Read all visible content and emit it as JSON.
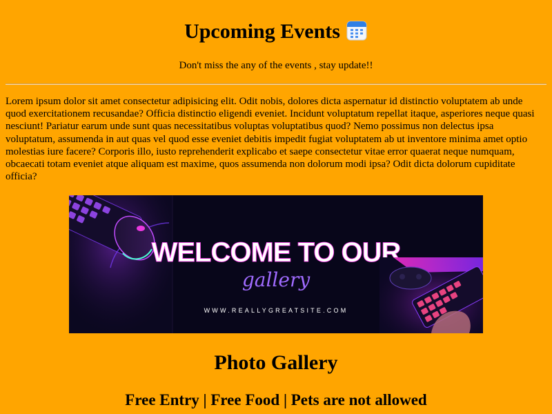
{
  "header": {
    "title": "Upcoming Events",
    "title_icon": "calendar-icon",
    "subtitle": "Don't miss the any of the events , stay update!!"
  },
  "intro": {
    "text": "Lorem ipsum dolor sit amet consectetur adipisicing elit. Odit nobis, dolores dicta aspernatur id distinctio voluptatem ab unde quod exercitationem recusandae? Officia distinctio eligendi eveniet. Incidunt voluptatum repellat itaque, asperiores neque quasi nesciunt! Pariatur earum unde sunt quas necessitatibus voluptas voluptatibus quod? Nemo possimus non delectus ipsa voluptatum, assumenda in aut quas vel quod esse eveniet debitis impedit fugiat voluptatem ab ut inventore minima amet optio molestias iure facere? Corporis illo, iusto reprehenderit explicabo et saepe consectetur vitae error quaerat neque numquam, obcaecati totam eveniet atque aliquam est maxime, quos assumenda non dolorum modi ipsa? Odit dicta dolorum cupiditate officia?"
  },
  "banner": {
    "headline": "WELCOME TO OUR",
    "script_text": "gallery",
    "website": "WWW.REALLYGREATSITE.COM"
  },
  "gallery": {
    "heading": "Photo Gallery"
  },
  "info": {
    "text": "Free Entry | Free Food | Pets are not allowed"
  },
  "colors": {
    "page_background": "#FFA500",
    "banner_background": "#08061a",
    "neon_pink": "#ff3df0",
    "neon_purple": "#9b5cff"
  }
}
